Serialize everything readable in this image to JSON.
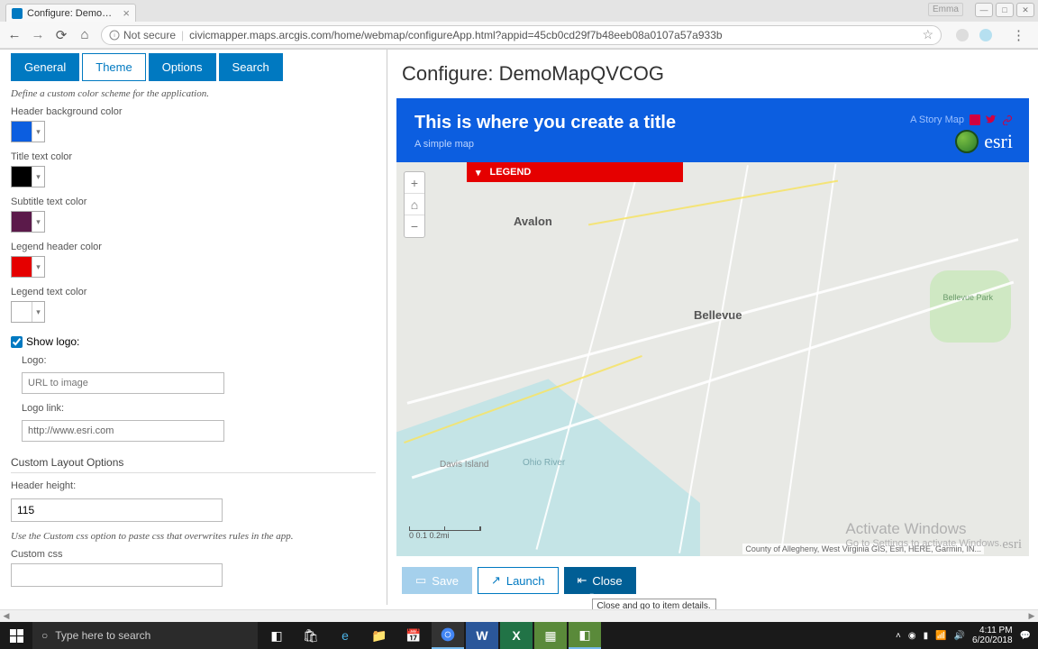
{
  "browser": {
    "tab_title": "Configure: DemoMapQV",
    "insecure_label": "Not secure",
    "url": "civicmapper.maps.arcgis.com/home/webmap/configureApp.html?appid=45cb0cd29f7b48eeb08a0107a57a933b",
    "title_overlay": "Emma"
  },
  "tabs": {
    "general": "General",
    "theme": "Theme",
    "options": "Options",
    "search": "Search"
  },
  "panel": {
    "intro": "Define a custom color scheme for the application.",
    "labels": {
      "header_bg": "Header background color",
      "title_text": "Title text color",
      "subtitle_text": "Subtitle text color",
      "legend_header": "Legend header color",
      "legend_text": "Legend text color",
      "show_logo": "Show logo:",
      "logo": "Logo:",
      "logo_link": "Logo link:",
      "custom_layout": "Custom Layout Options",
      "header_height": "Header height:",
      "css_note": "Use the Custom css option to paste css that overwrites rules in the app.",
      "custom_css": "Custom css"
    },
    "colors": {
      "header_bg": "#0c5ee0",
      "title_text": "#000000",
      "subtitle_text": "#5b1a4a",
      "legend_header": "#e50000",
      "legend_text": "#ffffff"
    },
    "logo_placeholder": "URL to image",
    "logo_link_value": "http://www.esri.com",
    "header_height_value": "115"
  },
  "preview": {
    "page_title": "Configure: DemoMapQVCOG",
    "banner_title": "This is where you create a title",
    "banner_sub": "A simple map",
    "story_link": "A Story Map",
    "legend": "LEGEND",
    "city1": "Avalon",
    "city2": "Bellevue",
    "island": "Davis Island",
    "river": "Ohio River",
    "park": "Bellevue Park",
    "attribution": "County of Allegheny, West Virginia GIS, Esri, HERE, Garmin, IN...",
    "scale_labels": "0    0.1    0.2mi"
  },
  "buttons": {
    "save": "Save",
    "launch": "Launch",
    "close": "Close",
    "close_tooltip": "Close and go to item details."
  },
  "activate": {
    "line1": "Activate Windows",
    "line2": "Go to Settings to activate Windows."
  },
  "taskbar": {
    "search_placeholder": "Type here to search",
    "time": "4:11 PM",
    "date": "6/20/2018"
  }
}
